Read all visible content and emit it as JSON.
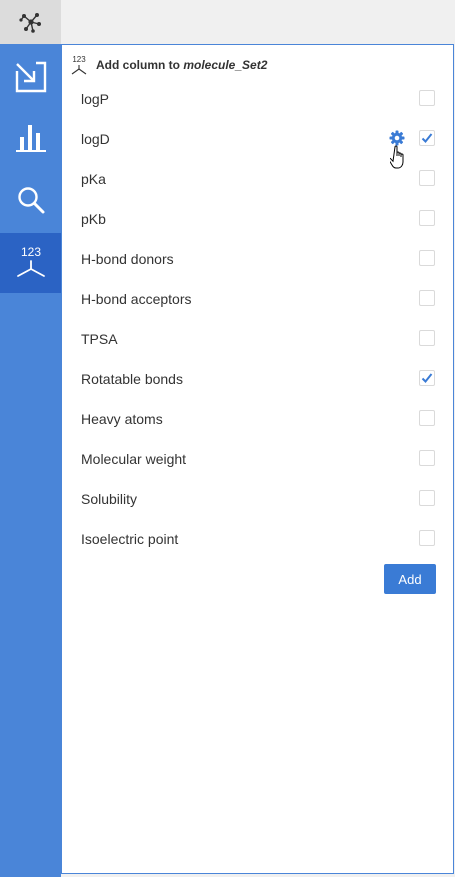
{
  "colors": {
    "sidebar": "#4a85d8",
    "active": "#2b63c4",
    "accent": "#3a7bd5"
  },
  "sidebar": {
    "items": [
      {
        "name": "import-icon"
      },
      {
        "name": "chart-icon"
      },
      {
        "name": "search-icon"
      },
      {
        "name": "calculator-icon",
        "label": "123",
        "active": true
      }
    ]
  },
  "panel": {
    "icon_label": "123",
    "title_prefix": "Add column to ",
    "dataset_name": "molecule_Set2",
    "add_label": "Add"
  },
  "properties": [
    {
      "label": "logP",
      "checked": false
    },
    {
      "label": "logD",
      "checked": true,
      "has_settings": true
    },
    {
      "label": "pKa",
      "checked": false
    },
    {
      "label": "pKb",
      "checked": false
    },
    {
      "label": "H-bond donors",
      "checked": false
    },
    {
      "label": "H-bond acceptors",
      "checked": false
    },
    {
      "label": "TPSA",
      "checked": false
    },
    {
      "label": "Rotatable bonds",
      "checked": true
    },
    {
      "label": "Heavy atoms",
      "checked": false
    },
    {
      "label": "Molecular weight",
      "checked": false
    },
    {
      "label": "Solubility",
      "checked": false
    },
    {
      "label": "Isoelectric point",
      "checked": false
    }
  ]
}
